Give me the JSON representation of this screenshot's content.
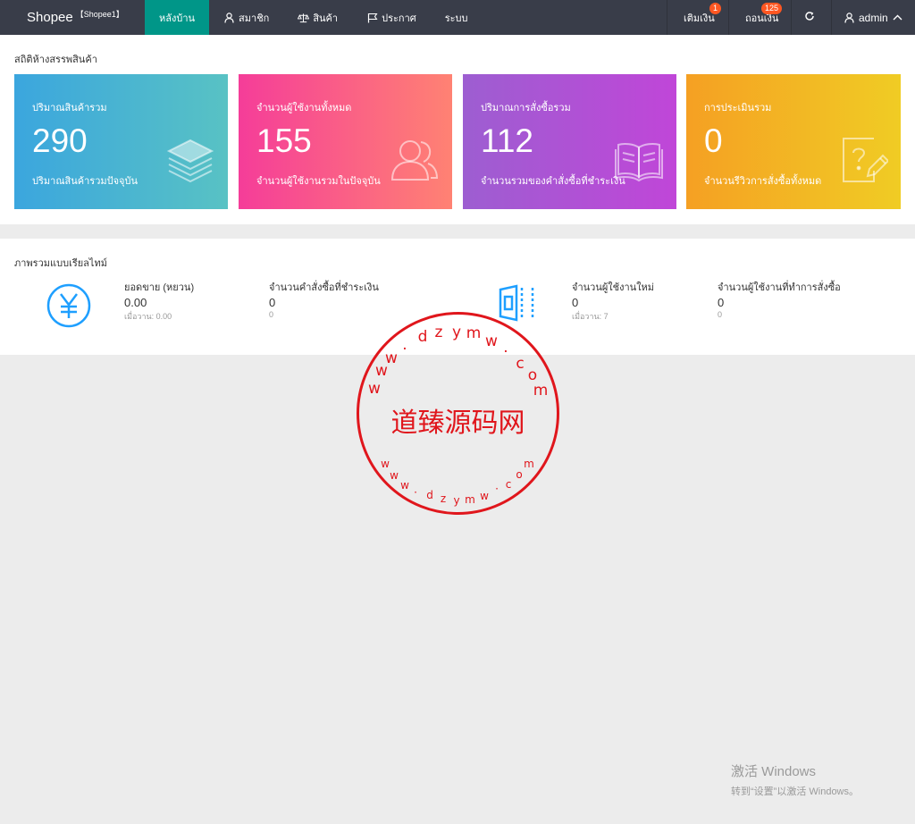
{
  "topbar": {
    "brand": "Shopee",
    "brand_tag": "【Shopee1】",
    "nav": [
      {
        "label": "หลังบ้าน",
        "icon": "",
        "active": true
      },
      {
        "label": "สมาชิก",
        "icon": "user-icon",
        "active": false
      },
      {
        "label": "สินค้า",
        "icon": "scale-icon",
        "active": false
      },
      {
        "label": "ประกาศ",
        "icon": "flag-icon",
        "active": false
      },
      {
        "label": "ระบบ",
        "icon": "",
        "active": false
      }
    ],
    "right": {
      "deposit_label": "เติมเงิน",
      "deposit_badge": "1",
      "withdraw_label": "ถอนเงิน",
      "withdraw_badge": "125",
      "refresh_icon": "refresh-icon",
      "user_label": "admin"
    }
  },
  "stats": {
    "title": "สถิติห้างสรรพสินค้า",
    "cards": [
      {
        "title": "ปริมาณสินค้ารวม",
        "value": "290",
        "desc": "ปริมาณสินค้ารวมปัจจุบัน",
        "icon": "layers-icon"
      },
      {
        "title": "จำนวนผู้ใช้งานทั้งหมด",
        "value": "155",
        "desc": "จำนวนผู้ใช้งานรวมในปัจจุบัน",
        "icon": "users-icon"
      },
      {
        "title": "ปริมาณการสั่งซื้อรวม",
        "value": "112",
        "desc": "จำนวนรวมของคำสั่งซื้อที่ชำระเงิน",
        "icon": "book-icon"
      },
      {
        "title": "การประเมินรวม",
        "value": "0",
        "desc": "จำนวนรีวิวการสั่งซื้อทั้งหมด",
        "icon": "edit-question-icon"
      }
    ]
  },
  "realtime": {
    "title": "ภาพรวมแบบเรียลไทม์",
    "blocks": [
      {
        "label": "ยอดขาย (หยวน)",
        "value": "0.00",
        "sub": "เมื่อวาน: 0.00"
      },
      {
        "label": "จำนวนคำสั่งซื้อที่ชำระเงิน",
        "value": "0",
        "sub": "0"
      },
      {
        "label": "จำนวนผู้ใช้งานใหม่",
        "value": "0",
        "sub": "เมื่อวาน: 7"
      },
      {
        "label": "จำนวนผู้ใช้งานที่ทำการสั่งซื้อ",
        "value": "0",
        "sub": "0"
      }
    ]
  },
  "watermark": {
    "center_text": "道臻源码网",
    "ring_text": "www.dzymw.com",
    "color": "#e0161c"
  },
  "windows_activation": {
    "line1": "激活 Windows",
    "line2": "转到“设置”以激活 Windows。"
  }
}
